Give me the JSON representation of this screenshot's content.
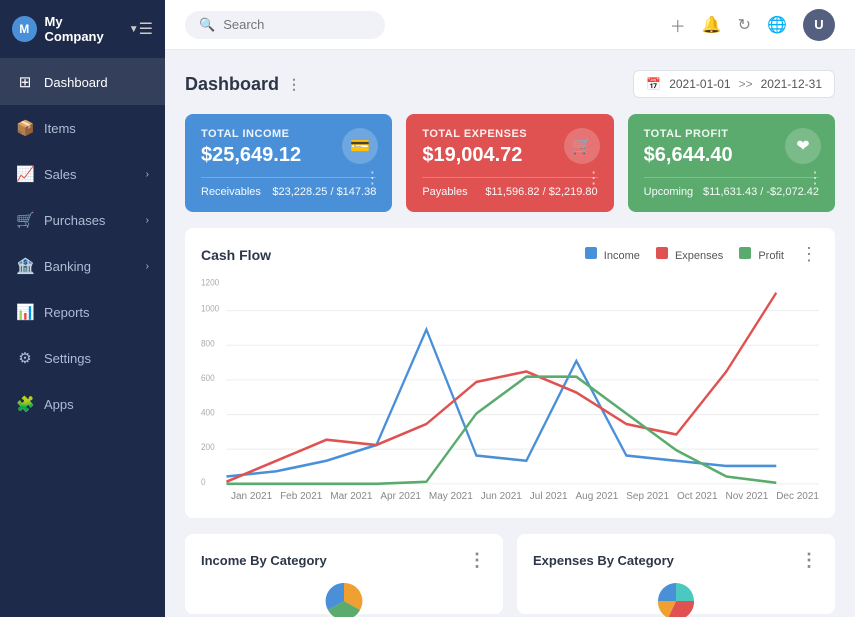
{
  "sidebar": {
    "company": "My Company",
    "logo_initial": "M",
    "items": [
      {
        "id": "dashboard",
        "label": "Dashboard",
        "icon": "⊞",
        "active": true,
        "has_chevron": false
      },
      {
        "id": "items",
        "label": "Items",
        "icon": "📦",
        "active": false,
        "has_chevron": false
      },
      {
        "id": "sales",
        "label": "Sales",
        "icon": "📈",
        "active": false,
        "has_chevron": true
      },
      {
        "id": "purchases",
        "label": "Purchases",
        "icon": "🛒",
        "active": false,
        "has_chevron": true
      },
      {
        "id": "banking",
        "label": "Banking",
        "icon": "🏦",
        "active": false,
        "has_chevron": true
      },
      {
        "id": "reports",
        "label": "Reports",
        "icon": "📊",
        "active": false,
        "has_chevron": false
      },
      {
        "id": "settings",
        "label": "Settings",
        "icon": "⚙",
        "active": false,
        "has_chevron": false
      },
      {
        "id": "apps",
        "label": "Apps",
        "icon": "🧩",
        "active": false,
        "has_chevron": false
      }
    ]
  },
  "topbar": {
    "search_placeholder": "Search",
    "avatar_initial": "U"
  },
  "dashboard": {
    "title": "Dashboard",
    "date_start": "2021-01-01",
    "date_end": "2021-12-31"
  },
  "stats": {
    "income": {
      "label": "TOTAL INCOME",
      "amount": "$25,649.12",
      "sub_label": "Receivables",
      "sub_value": "$23,228.25 / $147.38",
      "icon": "💳",
      "color": "blue"
    },
    "expenses": {
      "label": "TOTAL EXPENSES",
      "amount": "$19,004.72",
      "sub_label": "Payables",
      "sub_value": "$11,596.82 / $2,219.80",
      "icon": "🛒",
      "color": "red"
    },
    "profit": {
      "label": "TOTAL PROFIT",
      "amount": "$6,644.40",
      "sub_label": "Upcoming",
      "sub_value": "$11,631.43 / -$2,072.42",
      "icon": "❤",
      "color": "green"
    }
  },
  "cashflow_chart": {
    "title": "Cash Flow",
    "legend": [
      {
        "label": "Income",
        "color": "#4a90d9"
      },
      {
        "label": "Expenses",
        "color": "#e05252"
      },
      {
        "label": "Profit",
        "color": "#5aab6d"
      }
    ],
    "x_labels": [
      "Jan 2021",
      "Feb 2021",
      "Mar 2021",
      "Apr 2021",
      "May 2021",
      "Jun 2021",
      "Jul 2021",
      "Aug 2021",
      "Sep 2021",
      "Oct 2021",
      "Nov 2021",
      "Dec 2021"
    ],
    "y_labels": [
      "0",
      "200",
      "400",
      "600",
      "800",
      "1000",
      "1200"
    ]
  },
  "bottom_cards": {
    "income_by_category": "Income By Category",
    "expenses_by_category": "Expenses By Category"
  }
}
